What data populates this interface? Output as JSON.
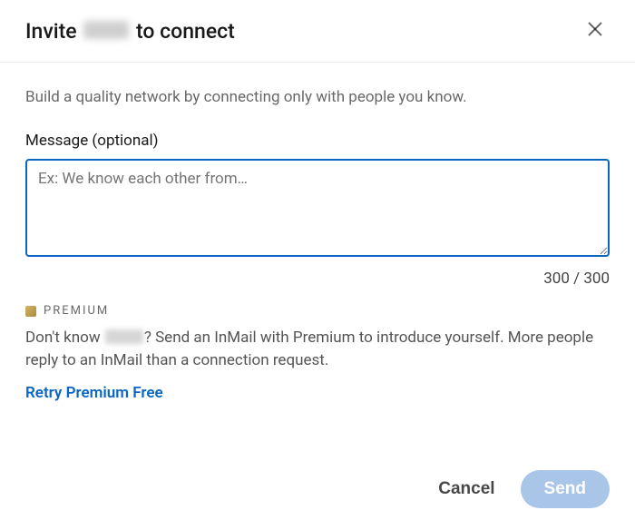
{
  "header": {
    "title_prefix": "Invite ",
    "title_suffix": " to connect"
  },
  "body": {
    "subtitle": "Build a quality network by connecting only with people you know.",
    "message_label": "Message (optional)",
    "message_placeholder": "Ex: We know each other from…",
    "message_value": "",
    "counter": "300 / 300"
  },
  "premium": {
    "badge": "PREMIUM",
    "text_prefix": "Don't know ",
    "text_suffix": "? Send an InMail with Premium to introduce yourself. More people reply to an InMail than a connection request.",
    "retry_label": "Retry Premium Free"
  },
  "footer": {
    "cancel_label": "Cancel",
    "send_label": "Send"
  }
}
